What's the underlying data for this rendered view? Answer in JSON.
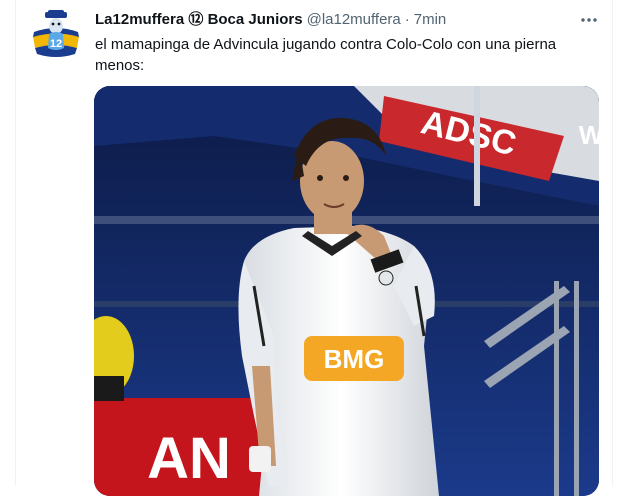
{
  "tweet": {
    "author": {
      "display_name": "La12muffera",
      "emoji": "⑫",
      "affiliation": "Boca Juniors",
      "handle": "@la12muffera",
      "avatar_label": "12"
    },
    "separator": "·",
    "timestamp": "7min",
    "text": "el mamapinga de Advincula jugando contra Colo-Colo con una pierna menos:",
    "media": {
      "banner_text": "ADSC",
      "sponsor_text": "BMG",
      "sign_text": "AN",
      "side_letter": "W"
    }
  },
  "colors": {
    "text_primary": "#0f1419",
    "text_secondary": "#536471",
    "border": "#eff3f4",
    "boca_blue": "#1a3d8f",
    "boca_yellow": "#f2b705"
  },
  "icons": {
    "more": "more-horizontal-icon"
  }
}
